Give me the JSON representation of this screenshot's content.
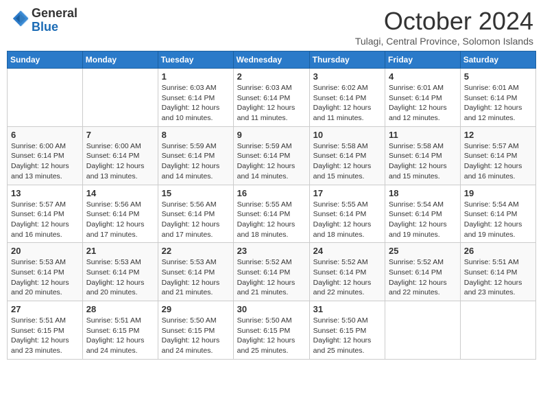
{
  "header": {
    "logo_general": "General",
    "logo_blue": "Blue",
    "month_title": "October 2024",
    "location": "Tulagi, Central Province, Solomon Islands"
  },
  "days_of_week": [
    "Sunday",
    "Monday",
    "Tuesday",
    "Wednesday",
    "Thursday",
    "Friday",
    "Saturday"
  ],
  "weeks": [
    [
      {
        "day": "",
        "info": ""
      },
      {
        "day": "",
        "info": ""
      },
      {
        "day": "1",
        "info": "Sunrise: 6:03 AM\nSunset: 6:14 PM\nDaylight: 12 hours and 10 minutes."
      },
      {
        "day": "2",
        "info": "Sunrise: 6:03 AM\nSunset: 6:14 PM\nDaylight: 12 hours and 11 minutes."
      },
      {
        "day": "3",
        "info": "Sunrise: 6:02 AM\nSunset: 6:14 PM\nDaylight: 12 hours and 11 minutes."
      },
      {
        "day": "4",
        "info": "Sunrise: 6:01 AM\nSunset: 6:14 PM\nDaylight: 12 hours and 12 minutes."
      },
      {
        "day": "5",
        "info": "Sunrise: 6:01 AM\nSunset: 6:14 PM\nDaylight: 12 hours and 12 minutes."
      }
    ],
    [
      {
        "day": "6",
        "info": "Sunrise: 6:00 AM\nSunset: 6:14 PM\nDaylight: 12 hours and 13 minutes."
      },
      {
        "day": "7",
        "info": "Sunrise: 6:00 AM\nSunset: 6:14 PM\nDaylight: 12 hours and 13 minutes."
      },
      {
        "day": "8",
        "info": "Sunrise: 5:59 AM\nSunset: 6:14 PM\nDaylight: 12 hours and 14 minutes."
      },
      {
        "day": "9",
        "info": "Sunrise: 5:59 AM\nSunset: 6:14 PM\nDaylight: 12 hours and 14 minutes."
      },
      {
        "day": "10",
        "info": "Sunrise: 5:58 AM\nSunset: 6:14 PM\nDaylight: 12 hours and 15 minutes."
      },
      {
        "day": "11",
        "info": "Sunrise: 5:58 AM\nSunset: 6:14 PM\nDaylight: 12 hours and 15 minutes."
      },
      {
        "day": "12",
        "info": "Sunrise: 5:57 AM\nSunset: 6:14 PM\nDaylight: 12 hours and 16 minutes."
      }
    ],
    [
      {
        "day": "13",
        "info": "Sunrise: 5:57 AM\nSunset: 6:14 PM\nDaylight: 12 hours and 16 minutes."
      },
      {
        "day": "14",
        "info": "Sunrise: 5:56 AM\nSunset: 6:14 PM\nDaylight: 12 hours and 17 minutes."
      },
      {
        "day": "15",
        "info": "Sunrise: 5:56 AM\nSunset: 6:14 PM\nDaylight: 12 hours and 17 minutes."
      },
      {
        "day": "16",
        "info": "Sunrise: 5:55 AM\nSunset: 6:14 PM\nDaylight: 12 hours and 18 minutes."
      },
      {
        "day": "17",
        "info": "Sunrise: 5:55 AM\nSunset: 6:14 PM\nDaylight: 12 hours and 18 minutes."
      },
      {
        "day": "18",
        "info": "Sunrise: 5:54 AM\nSunset: 6:14 PM\nDaylight: 12 hours and 19 minutes."
      },
      {
        "day": "19",
        "info": "Sunrise: 5:54 AM\nSunset: 6:14 PM\nDaylight: 12 hours and 19 minutes."
      }
    ],
    [
      {
        "day": "20",
        "info": "Sunrise: 5:53 AM\nSunset: 6:14 PM\nDaylight: 12 hours and 20 minutes."
      },
      {
        "day": "21",
        "info": "Sunrise: 5:53 AM\nSunset: 6:14 PM\nDaylight: 12 hours and 20 minutes."
      },
      {
        "day": "22",
        "info": "Sunrise: 5:53 AM\nSunset: 6:14 PM\nDaylight: 12 hours and 21 minutes."
      },
      {
        "day": "23",
        "info": "Sunrise: 5:52 AM\nSunset: 6:14 PM\nDaylight: 12 hours and 21 minutes."
      },
      {
        "day": "24",
        "info": "Sunrise: 5:52 AM\nSunset: 6:14 PM\nDaylight: 12 hours and 22 minutes."
      },
      {
        "day": "25",
        "info": "Sunrise: 5:52 AM\nSunset: 6:14 PM\nDaylight: 12 hours and 22 minutes."
      },
      {
        "day": "26",
        "info": "Sunrise: 5:51 AM\nSunset: 6:14 PM\nDaylight: 12 hours and 23 minutes."
      }
    ],
    [
      {
        "day": "27",
        "info": "Sunrise: 5:51 AM\nSunset: 6:15 PM\nDaylight: 12 hours and 23 minutes."
      },
      {
        "day": "28",
        "info": "Sunrise: 5:51 AM\nSunset: 6:15 PM\nDaylight: 12 hours and 24 minutes."
      },
      {
        "day": "29",
        "info": "Sunrise: 5:50 AM\nSunset: 6:15 PM\nDaylight: 12 hours and 24 minutes."
      },
      {
        "day": "30",
        "info": "Sunrise: 5:50 AM\nSunset: 6:15 PM\nDaylight: 12 hours and 25 minutes."
      },
      {
        "day": "31",
        "info": "Sunrise: 5:50 AM\nSunset: 6:15 PM\nDaylight: 12 hours and 25 minutes."
      },
      {
        "day": "",
        "info": ""
      },
      {
        "day": "",
        "info": ""
      }
    ]
  ]
}
